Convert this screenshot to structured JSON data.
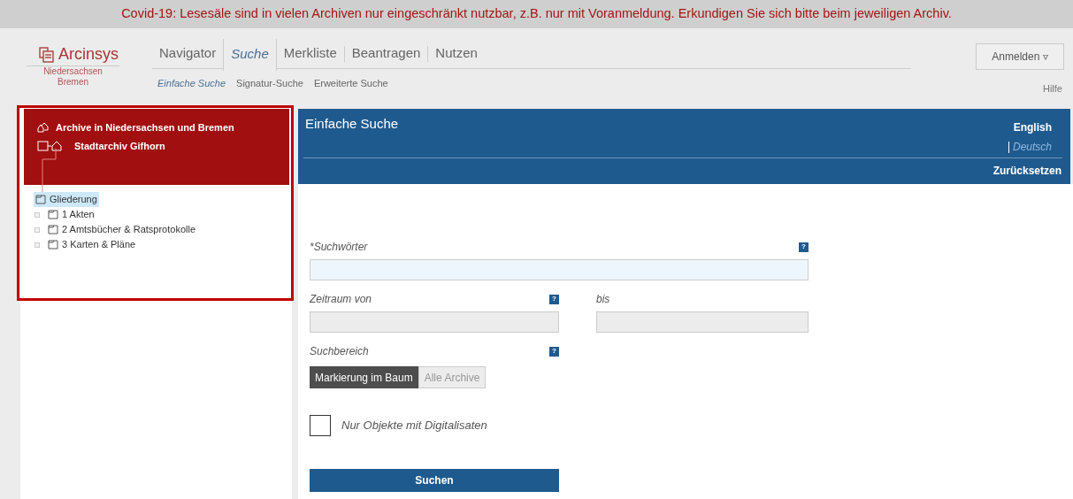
{
  "notice": "Covid-19: Lesesäle sind in vielen Archiven nur eingeschränkt nutzbar, z.B. nur mit Voranmeldung. Erkundigen Sie sich bitte beim jeweiligen Archiv.",
  "logo": {
    "name": "Arcinsys",
    "region_line1": "Niedersachsen",
    "region_line2": "Bremen"
  },
  "tabs": [
    {
      "label": "Navigator",
      "selected": false
    },
    {
      "label": "Suche",
      "selected": true
    },
    {
      "label": "Merkliste",
      "selected": false
    },
    {
      "label": "Beantragen",
      "selected": false
    },
    {
      "label": "Nutzen",
      "selected": false
    }
  ],
  "subtabs": [
    {
      "label": "Einfache Suche",
      "selected": true
    },
    {
      "label": "Signatur-Suche",
      "selected": false
    },
    {
      "label": "Erweiterte Suche",
      "selected": false
    }
  ],
  "login_button": "Anmelden ▿",
  "help_link": "Hilfe",
  "tree_header": {
    "root": "Archive in Niedersachsen und Bremen",
    "archive": "Stadtarchiv Gifhorn"
  },
  "tree": [
    {
      "label": "Gliederung",
      "selected": true,
      "children": [
        {
          "label": "1 Akten",
          "selected": false
        },
        {
          "label": "2 Amtsbücher & Ratsprotokolle",
          "selected": false
        },
        {
          "label": "3 Karten & Pläne",
          "selected": false
        }
      ]
    }
  ],
  "panel": {
    "title": "Einfache Suche",
    "languages": [
      {
        "label": "English",
        "selected": false
      },
      {
        "label": "Deutsch",
        "selected": true
      }
    ],
    "reset": "Zurücksetzen"
  },
  "form": {
    "keywords_label": "*Suchwörter",
    "from_label": "Zeitraum von",
    "to_label": "bis",
    "scope_label": "Suchbereich",
    "scope_options": [
      {
        "label": "Markierung im Baum",
        "selected": true
      },
      {
        "label": "Alle Archive",
        "selected": false
      }
    ],
    "digital_only": {
      "label": "Nur Objekte mit Digitalisaten",
      "checked": false
    },
    "help_marks": [
      "?",
      "?",
      "?"
    ],
    "submit": "Suchen"
  }
}
